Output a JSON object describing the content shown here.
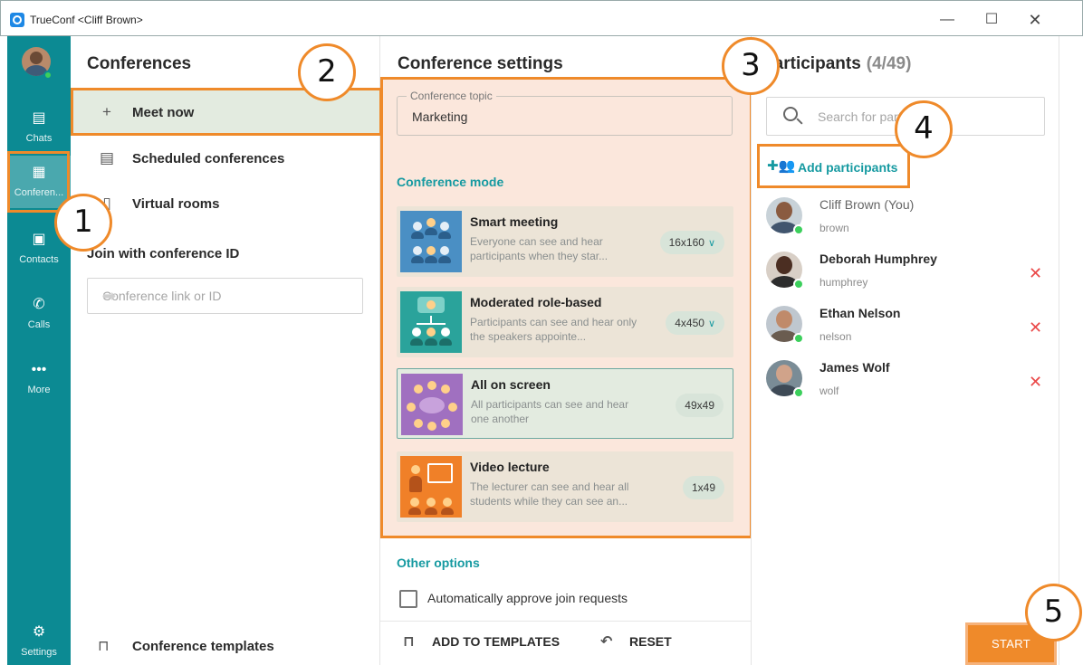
{
  "window": {
    "title": "TrueConf <Cliff Brown>",
    "minimize": "—",
    "maximize": "☐",
    "close": "✕"
  },
  "rail": {
    "items": [
      {
        "label": "Chats",
        "icon": "chat-icon"
      },
      {
        "label": "Conferen...",
        "icon": "conference-icon"
      },
      {
        "label": "Contacts",
        "icon": "contacts-icon"
      },
      {
        "label": "Calls",
        "icon": "calls-icon"
      },
      {
        "label": "More",
        "icon": "more-icon"
      },
      {
        "label": "Settings",
        "icon": "gear-icon"
      }
    ]
  },
  "conferences": {
    "title": "Conferences",
    "nav": [
      {
        "label": "Meet now",
        "icon": "plus-icon"
      },
      {
        "label": "Scheduled conferences",
        "icon": "calendar-icon"
      },
      {
        "label": "Virtual rooms",
        "icon": "room-icon"
      }
    ],
    "join_label": "Join with conference ID",
    "join_placeholder": "Conference link or ID",
    "templates_label": "Conference templates"
  },
  "settings": {
    "title": "Conference settings",
    "topic_legend": "Conference topic",
    "topic_value": "Marketing",
    "mode_label": "Conference mode",
    "modes": [
      {
        "title": "Smart meeting",
        "desc": "Everyone can see and hear participants when they star...",
        "badge": "16x160",
        "selected": false,
        "has_dropdown": true
      },
      {
        "title": "Moderated role-based",
        "desc": "Participants can see and hear only the speakers appointe...",
        "badge": "4x450",
        "selected": false,
        "has_dropdown": true
      },
      {
        "title": "All on screen",
        "desc": "All participants can see and hear one another",
        "badge": "49x49",
        "selected": true,
        "has_dropdown": false
      },
      {
        "title": "Video lecture",
        "desc": "The lecturer can see and hear all students while they can see an...",
        "badge": "1x49",
        "selected": false,
        "has_dropdown": false
      }
    ],
    "other_label": "Other options",
    "auto_approve_label": "Automatically approve join requests",
    "auto_approve_checked": false,
    "add_templates_label": "ADD TO TEMPLATES",
    "reset_label": "RESET"
  },
  "participants": {
    "title": "Participants",
    "count": "(4/49)",
    "search_placeholder": "Search for participants",
    "add_label": "Add participants",
    "list": [
      {
        "name": "Cliff Brown (You)",
        "login": "brown",
        "removable": false
      },
      {
        "name": "Deborah Humphrey",
        "login": "humphrey",
        "removable": true
      },
      {
        "name": "Ethan Nelson",
        "login": "nelson",
        "removable": true
      },
      {
        "name": "James Wolf",
        "login": "wolf",
        "removable": true
      }
    ],
    "start_label": "START"
  },
  "callouts": [
    "1",
    "2",
    "3",
    "4",
    "5"
  ],
  "colors": {
    "accent": "#169aa1",
    "rail": "#0c8a93",
    "highlight": "#ef8a2a",
    "settings_bg": "#fbe7dc",
    "remove": "#ea4848"
  }
}
